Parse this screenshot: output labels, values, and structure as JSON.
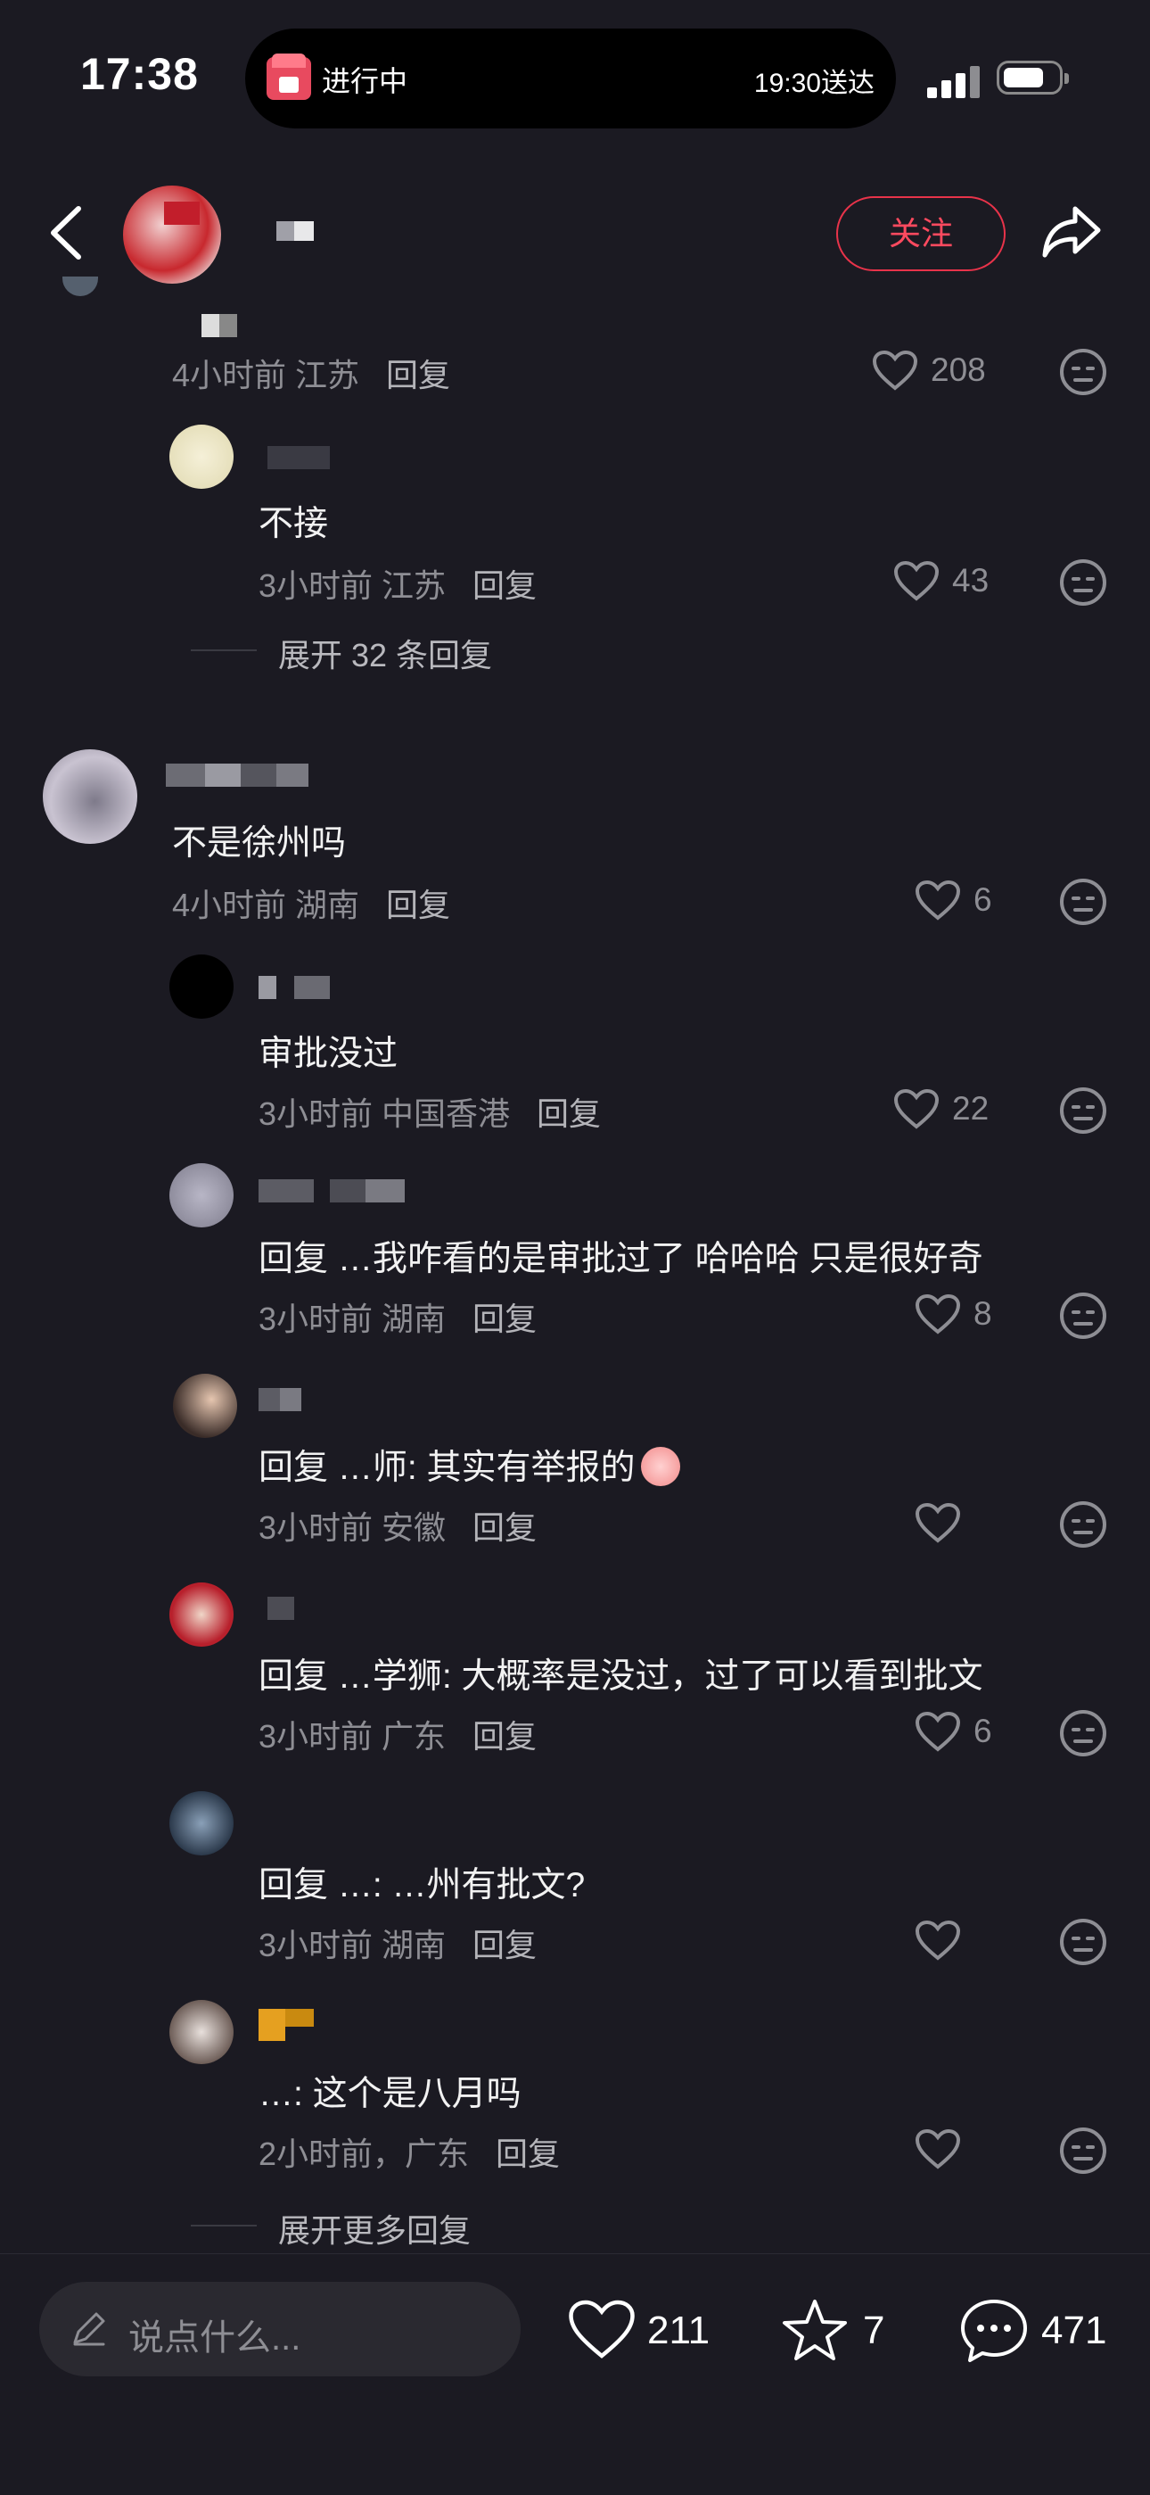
{
  "status_bar": {
    "time": "17:38",
    "live_activity": {
      "status": "进行中",
      "eta": "19:30送达",
      "icon": "shop-icon"
    }
  },
  "header": {
    "follow_label": "关注",
    "icons": [
      "back-arrow-icon",
      "share-icon"
    ]
  },
  "comments": [
    {
      "id": "c0",
      "meta": "4小时前 江苏",
      "reply": "回复",
      "likes": "208"
    },
    {
      "id": "c1",
      "text": "不接",
      "meta": "3小时前 江苏",
      "reply": "回复",
      "likes": "43"
    },
    {
      "id": "expand1",
      "expand": "展开 32 条回复"
    },
    {
      "id": "c2",
      "text": "不是徐州吗",
      "meta": "4小时前 湖南",
      "reply": "回复",
      "likes": "6"
    },
    {
      "id": "c3",
      "text": "审批没过",
      "meta": "3小时前 中国香港",
      "reply": "回复",
      "likes": "22"
    },
    {
      "id": "c4",
      "text": "回复 …我咋看的是审批过了 哈哈哈 只是很好奇",
      "meta": "3小时前 湖南",
      "reply": "回复",
      "likes": "8"
    },
    {
      "id": "c5",
      "text": "回复 …师: 其实有举报的",
      "meta": "3小时前 安徽",
      "reply": "回复",
      "likes": ""
    },
    {
      "id": "c6",
      "text": "回复 …学狮: 大概率是没过，过了可以看到批文",
      "meta": "3小时前 广东",
      "reply": "回复",
      "likes": "6"
    },
    {
      "id": "c7",
      "text": "回复 …: …州有批文?",
      "meta": "3小时前 湖南",
      "reply": "回复",
      "likes": ""
    },
    {
      "id": "c8",
      "text": "…: 这个是八月吗",
      "meta": "2小时前，广东",
      "reply": "回复",
      "likes": ""
    },
    {
      "id": "expand2",
      "expand": "展开更多回复"
    }
  ],
  "bottom_bar": {
    "placeholder": "说点什么...",
    "like_count": "211",
    "star_count": "7",
    "comment_count": "471"
  },
  "colors": {
    "background": "#1b1a22",
    "accent": "#ff4a5f",
    "muted": "#8e8e94"
  }
}
